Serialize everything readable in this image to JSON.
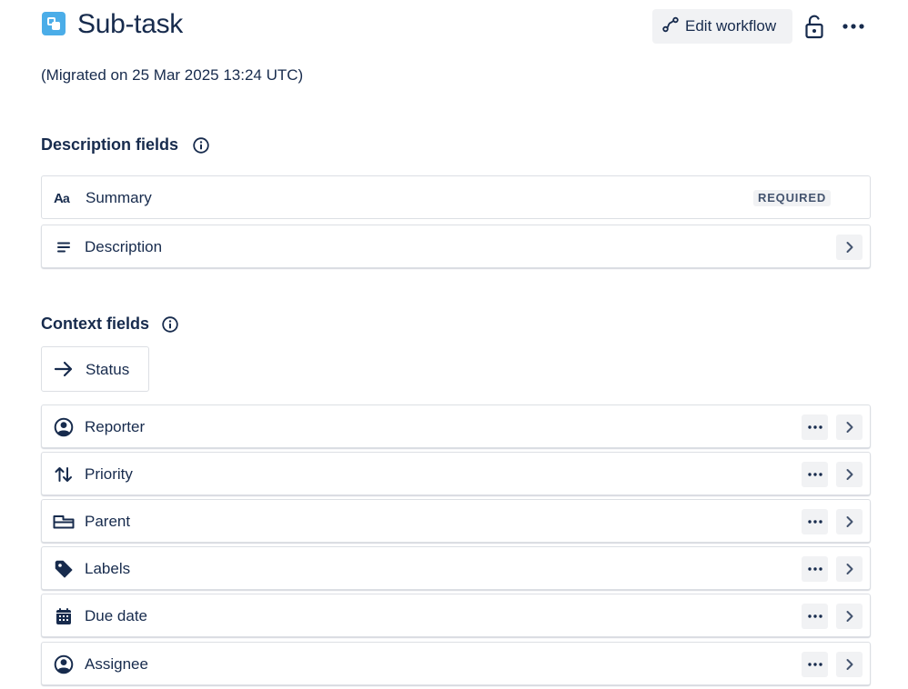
{
  "header": {
    "title": "Sub-task",
    "edit_workflow_label": "Edit workflow",
    "type_icon": "subtask-icon",
    "accent_color": "#4bade8"
  },
  "migrated_note": "(Migrated on 25 Mar 2025 13:24 UTC)",
  "description_section": {
    "title": "Description fields",
    "fields": [
      {
        "label": "Summary",
        "icon": "text-aa-icon",
        "badge": "REQUIRED"
      },
      {
        "label": "Description",
        "icon": "text-lines-icon"
      }
    ]
  },
  "context_section": {
    "title": "Context fields",
    "status_label": "Status",
    "fields": [
      {
        "label": "Reporter",
        "icon": "user-avatar-icon"
      },
      {
        "label": "Priority",
        "icon": "priority-arrows-icon"
      },
      {
        "label": "Parent",
        "icon": "parent-icon"
      },
      {
        "label": "Labels",
        "icon": "tag-icon"
      },
      {
        "label": "Due date",
        "icon": "calendar-icon"
      },
      {
        "label": "Assignee",
        "icon": "user-avatar-icon"
      }
    ]
  }
}
